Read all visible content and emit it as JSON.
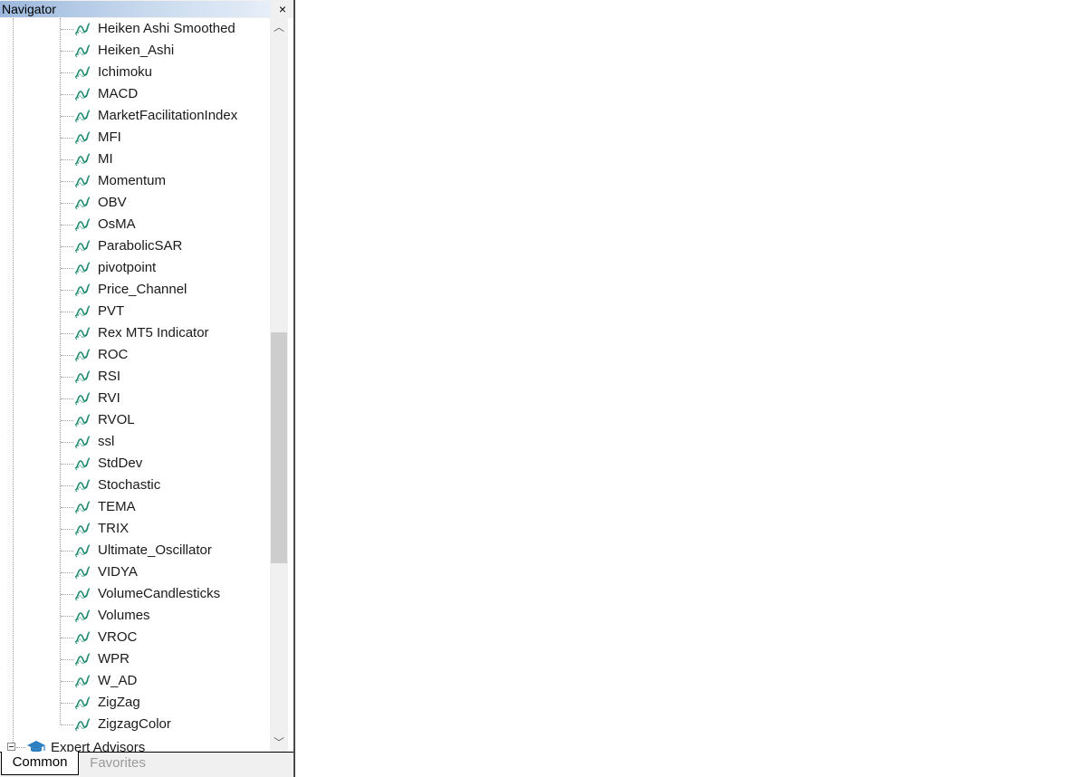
{
  "window": {
    "title": "Navigator",
    "close_label": "×"
  },
  "tree": {
    "indicators": [
      "Heiken Ashi Smoothed",
      "Heiken_Ashi",
      "Ichimoku",
      "MACD",
      "MarketFacilitationIndex",
      "MFI",
      "MI",
      "Momentum",
      "OBV",
      "OsMA",
      "ParabolicSAR",
      "pivotpoint",
      "Price_Channel",
      "PVT",
      "Rex MT5 Indicator",
      "ROC",
      "RSI",
      "RVI",
      "RVOL",
      "ssl",
      "StdDev",
      "Stochastic",
      "TEMA",
      "TRIX",
      "Ultimate_Oscillator",
      "VIDYA",
      "VolumeCandlesticks",
      "Volumes",
      "VROC",
      "WPR",
      "W_AD",
      "ZigZag",
      "ZigzagColor"
    ],
    "indicator_icon": "indicator-line-icon",
    "indicator_icon_color": "#1e8a6e",
    "expert_advisors": {
      "label": "Expert Advisors",
      "icon": "graduation-cap-icon",
      "icon_color": "#2e7fbf"
    }
  },
  "scrollbar": {
    "up_arrow": "︿",
    "down_arrow": "﹀"
  },
  "tabs": {
    "common": "Common",
    "favorites": "Favorites"
  }
}
